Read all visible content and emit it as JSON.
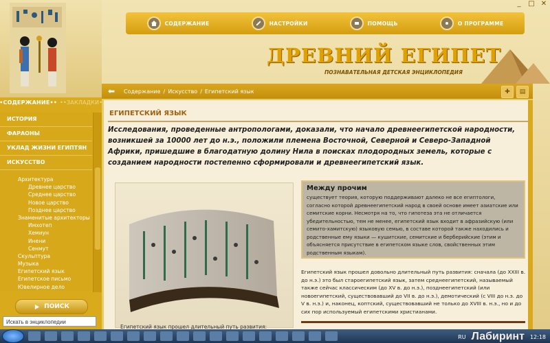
{
  "app": {
    "title": "ДРЕВНИЙ ЕГИПЕТ",
    "subtitle": "ПОЗНАВАТЕЛЬНАЯ ДЕТСКАЯ ЭНЦИКЛОПЕДИЯ",
    "window_controls": [
      "_",
      "□",
      "✕"
    ]
  },
  "top_menu": [
    {
      "label": "СОДЕРЖАНИЕ",
      "icon": "house-icon"
    },
    {
      "label": "НАСТРОЙКИ",
      "icon": "wrench-icon"
    },
    {
      "label": "ПОМОЩЬ",
      "icon": "help-icon"
    },
    {
      "label": "О ПРОГРАММЕ",
      "icon": "info-icon"
    }
  ],
  "sidebar": {
    "tabs": [
      "••СОДЕРЖАНИЕ••",
      "••ЗАКЛАДКИ••"
    ],
    "top_items": [
      "ИСТОРИЯ",
      "ФАРАОНЫ",
      "УКЛАД ЖИЗНИ ЕГИПТЯН",
      "ИСКУССТВО"
    ],
    "sub_items": [
      {
        "label": "Архитектура",
        "level": 1
      },
      {
        "label": "Древнее царство",
        "level": 2
      },
      {
        "label": "Среднее царство",
        "level": 2
      },
      {
        "label": "Новое царство",
        "level": 2
      },
      {
        "label": "Позднее царство",
        "level": 2
      },
      {
        "label": "Знаменитые архитекторы",
        "level": 1
      },
      {
        "label": "Имхотеп",
        "level": 2
      },
      {
        "label": "Хемиун",
        "level": 2
      },
      {
        "label": "Инени",
        "level": 2
      },
      {
        "label": "Сенмут",
        "level": 2
      },
      {
        "label": "Скульптура",
        "level": 1
      },
      {
        "label": "Музыка",
        "level": 1
      },
      {
        "label": "Египетский язык",
        "level": 1
      },
      {
        "label": "Египетское письмо",
        "level": 1
      },
      {
        "label": "Ювелирное дело",
        "level": 1
      }
    ],
    "search_button": "ПОИСК",
    "search_placeholder": "Искать в энциклопедии"
  },
  "breadcrumb": [
    "Содержание",
    "Искусство",
    "Египетский язык"
  ],
  "article": {
    "heading": "ЕГИПЕТСКИЙ ЯЗЫК",
    "lead": "Исследования, проведенные антропологами, доказали, что начало древнеегипетской народности, возникшей за 10000 лет до н.э., положили племена Восточной, Северной и Северо-Западной Африки, пришедшие в благодатную долину Нила в поисках плодородных земель, которые с созданием народности постепенно сформировали и древнеегипетский язык.",
    "note_title": "Между прочим",
    "note_text": "существует теория, которую поддерживают далеко не все египтологи, согласно которой древнеегипетский народ в своей основе имеет азиатские или семитские корни. Несмотря на то, что гипотеза эта не отличается убедительностью, тем не менее, египетский язык входит в афразийскую (или семито-хамитскую) языковую семью, в составе которой также находились и родственные ему языки — кушитские, семитские и берберийские (этим и объясняется присутствие в египетском языке слов, свойственных этим родственным языкам).",
    "body": "Египетский язык прошел довольно длительный путь развития: сначала (до XXIII в. до н.э.) это был староегипетский язык, затем среднеегипетский, называемый также сейчас классическим (до XV в. до н.э.), позднеегипетский (или новоегипетский, существовавший до VII в. до н.э.), демотический (с VIII до н.э. до V в. н.э.) и, наконец, коптский, существовавший не только до XVIII в. н.э., но и до сих пор используемый египетскими христианами.",
    "caption": "Египетский язык прошел длительный путь развития:"
  },
  "taskbar": {
    "lang": "RU",
    "time": "12:18",
    "watermark": "Лабиринт"
  },
  "colors": {
    "gold": "#d9ab1c",
    "heading": "#a2610d",
    "paper": "#f7efd9"
  }
}
